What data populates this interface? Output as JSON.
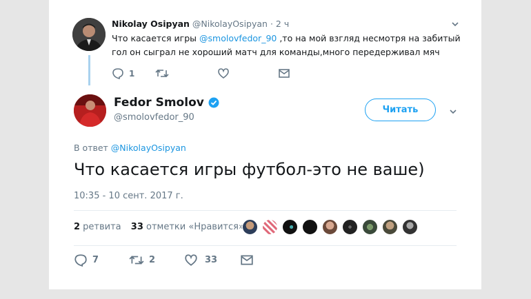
{
  "parent_tweet": {
    "name": "Nikolay Osipyan",
    "handle": "@NikolayOsipyan",
    "separator": "·",
    "time": "2 ч",
    "text_before": "Что касается игры ",
    "mention": "@smolovfedor_90",
    "text_after": " ,то на мой взгляд несмотря на забитый гол он сыграл не хороший матч для команды,много передерживал мяч",
    "actions": {
      "reply_icon": "reply-icon",
      "reply_count": "1",
      "retweet_icon": "retweet-icon",
      "like_icon": "heart-icon",
      "dm_icon": "envelope-icon"
    }
  },
  "main_tweet": {
    "name": "Fedor Smolov",
    "handle": "@smolovfedor_90",
    "verified_icon": "verified-badge-icon",
    "follow_label": "Читать",
    "reply_prefix": "В ответ ",
    "reply_to": "@NikolayOsipyan",
    "text": "Что касается игры футбол-это не ваше)",
    "timestamp": "10:35 - 10 сент. 2017 г.",
    "retweets_count": "2",
    "retweets_label": " ретвита",
    "likes_count": "33",
    "likes_label": " отметки «Нравится»",
    "actions": {
      "reply_count": "7",
      "retweet_count": "2",
      "like_count": "33"
    }
  },
  "colors": {
    "accent": "#1da1f2",
    "link": "#1b95e0",
    "muted": "#657786",
    "thread_line": "#a9d2ee",
    "verified": "#1da1f2"
  }
}
